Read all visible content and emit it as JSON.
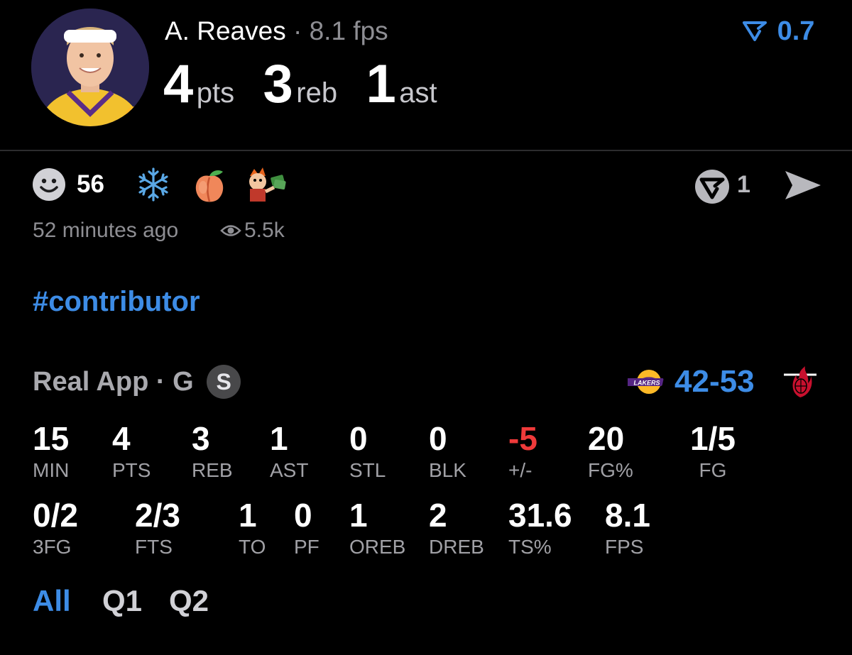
{
  "header": {
    "player_name": "A. Reaves",
    "separator": "·",
    "fps": "8.1 fps",
    "vote_score": "0.7",
    "headline": [
      {
        "value": "4",
        "unit": "pts"
      },
      {
        "value": "3",
        "unit": "reb"
      },
      {
        "value": "1",
        "unit": "ast"
      }
    ]
  },
  "reactions": {
    "count": "56",
    "icons": [
      "smiley-icon",
      "snowflake-icon",
      "peach-icon",
      "fry-money-icon"
    ],
    "replies_count": "1"
  },
  "meta": {
    "time": "52 minutes ago",
    "views": "5.5k"
  },
  "hashtag": "#contributor",
  "game": {
    "source": "Real App",
    "position": "G",
    "badge": "S",
    "score": "42-53"
  },
  "stats_row1": [
    {
      "value": "15",
      "label": "MIN"
    },
    {
      "value": "4",
      "label": "PTS"
    },
    {
      "value": "3",
      "label": "REB"
    },
    {
      "value": "1",
      "label": "AST"
    },
    {
      "value": "0",
      "label": "STL"
    },
    {
      "value": "0",
      "label": "BLK"
    },
    {
      "value": "-5",
      "label": "+/-"
    },
    {
      "value": "20",
      "label": "FG%"
    },
    {
      "value": "1/5",
      "label": "FG"
    }
  ],
  "stats_row2": [
    {
      "value": "0/2",
      "label": "3FG"
    },
    {
      "value": "2/3",
      "label": "FTS"
    },
    {
      "value": "1",
      "label": "TO"
    },
    {
      "value": "0",
      "label": "PF"
    },
    {
      "value": "1",
      "label": "OREB"
    },
    {
      "value": "2",
      "label": "DREB"
    },
    {
      "value": "31.6",
      "label": "TS%"
    },
    {
      "value": "8.1",
      "label": "FPS"
    }
  ],
  "tabs": [
    "All",
    "Q1",
    "Q2"
  ],
  "colors": {
    "accent": "#3d8ce6",
    "negative": "#ef3a3a",
    "lakers_purple": "#552583",
    "lakers_gold": "#fdb927",
    "heat_red": "#98002e"
  }
}
